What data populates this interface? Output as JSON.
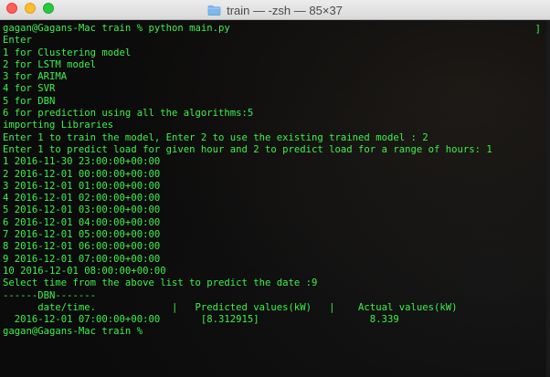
{
  "window": {
    "title": "train — -zsh — 85×37",
    "folder_icon": "folder-icon"
  },
  "terminal": {
    "text_color": "#3df04a",
    "background": "#0b0b0b",
    "edge_char": "]",
    "lines": [
      "gagan@Gagans-Mac train % python main.py",
      "Enter",
      "1 for Clustering model",
      "2 for LSTM model",
      "3 for ARIMA",
      "4 for SVR",
      "5 for DBN",
      "6 for prediction using all the algorithms:5",
      "importing Libraries",
      "Enter 1 to train the model, Enter 2 to use the existing trained model : 2",
      "Enter 1 to predict load for given hour and 2 to predict load for a range of hours: 1",
      "1 2016-11-30 23:00:00+00:00",
      "2 2016-12-01 00:00:00+00:00",
      "3 2016-12-01 01:00:00+00:00",
      "4 2016-12-01 02:00:00+00:00",
      "5 2016-12-01 03:00:00+00:00",
      "6 2016-12-01 04:00:00+00:00",
      "7 2016-12-01 05:00:00+00:00",
      "8 2016-12-01 06:00:00+00:00",
      "9 2016-12-01 07:00:00+00:00",
      "10 2016-12-01 08:00:00+00:00",
      "Select time from the above list to predict the date :9",
      "------DBN-------",
      "      date/time.             |   Predicted values(kW)   |    Actual values(kW)",
      "  2016-12-01 07:00:00+00:00       [8.312915]                   8.339",
      "gagan@Gagans-Mac train %"
    ]
  }
}
